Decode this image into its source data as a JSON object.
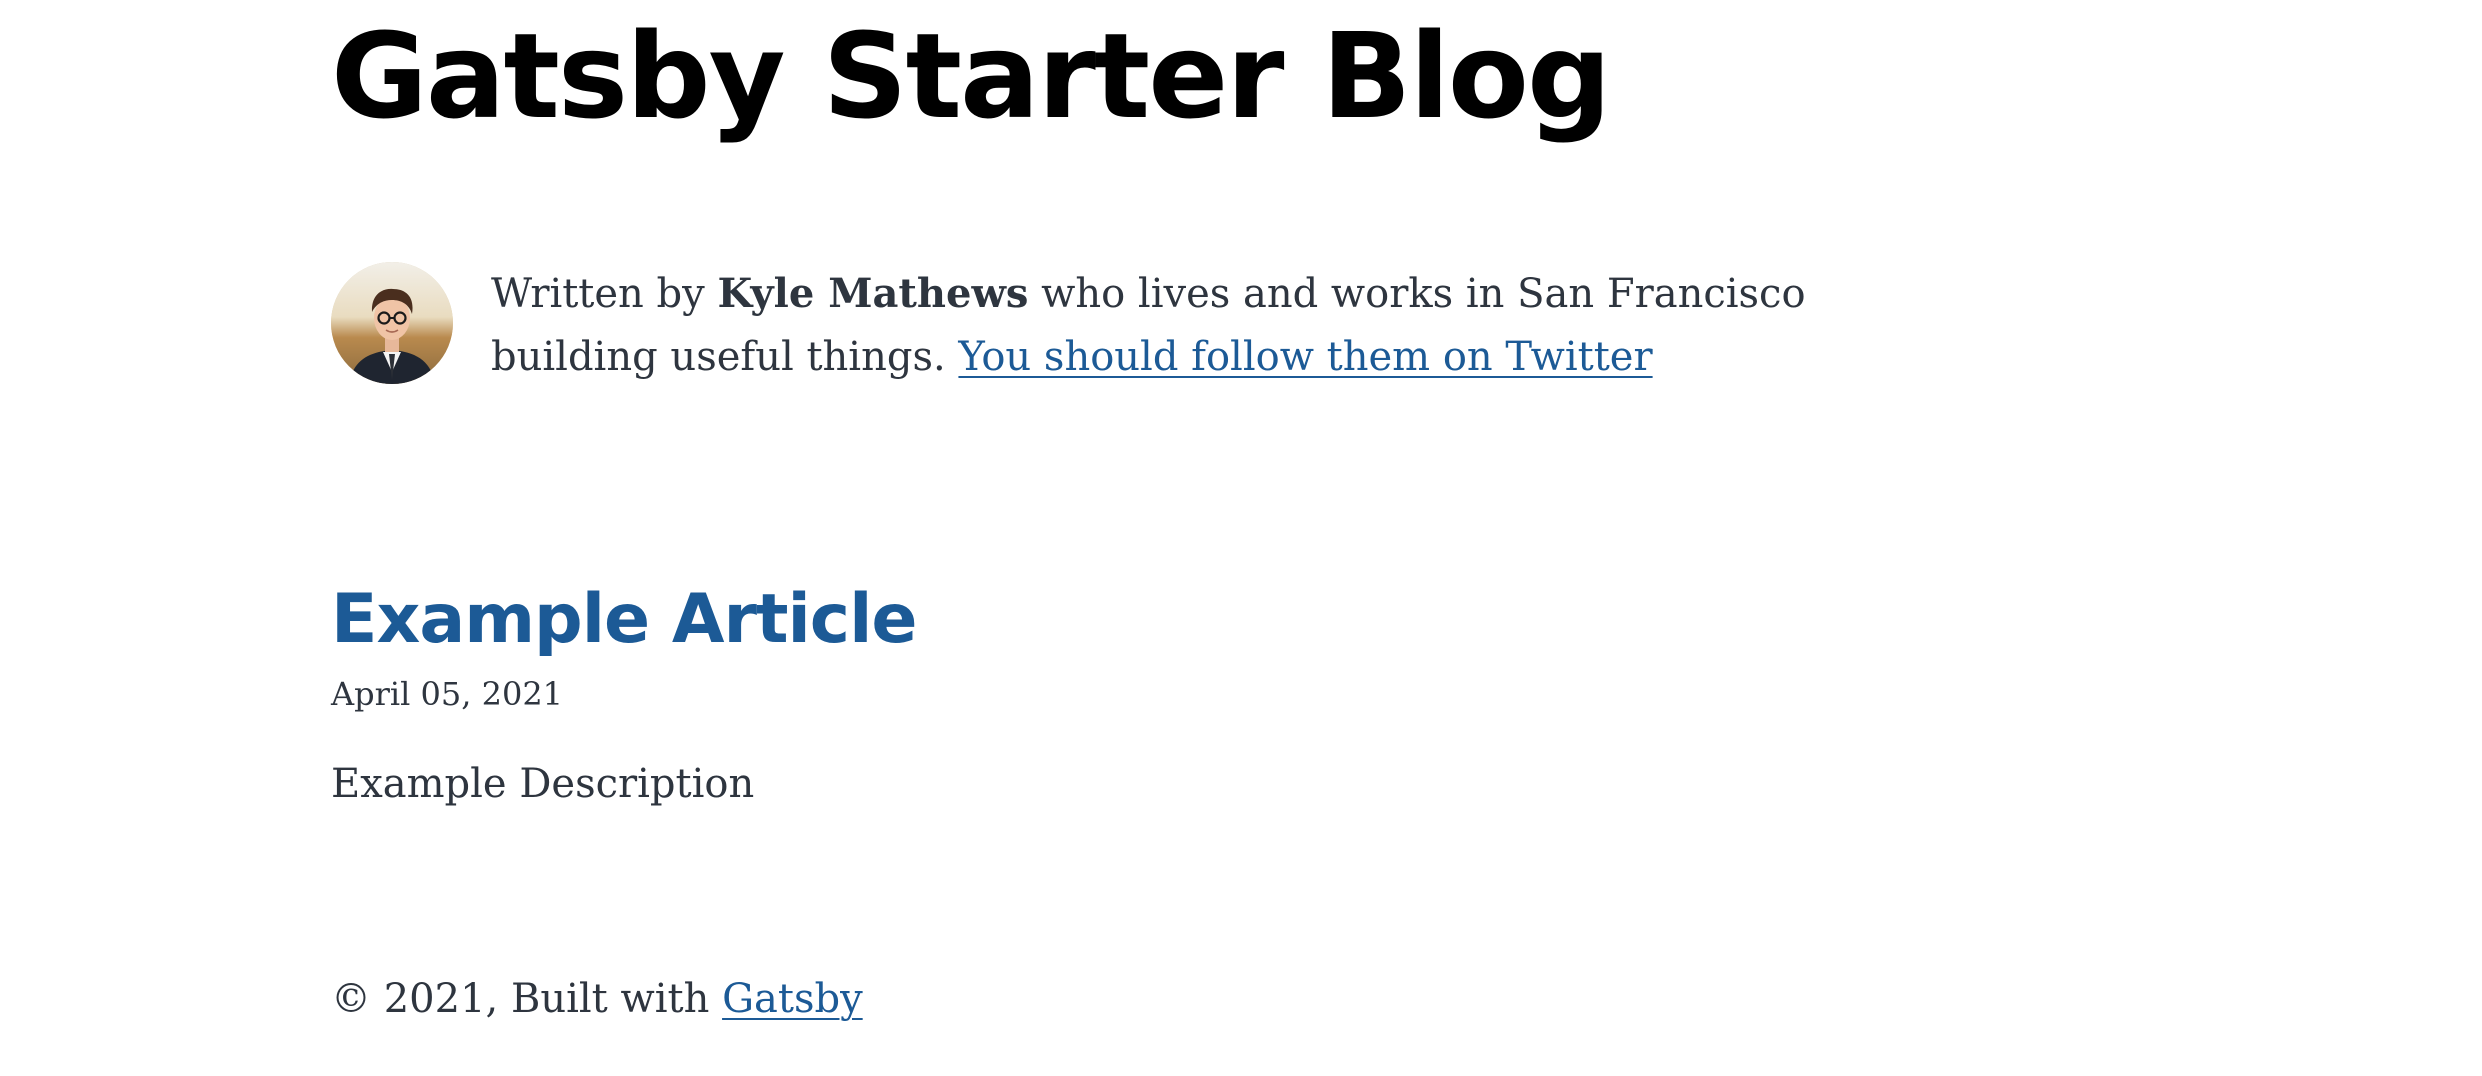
{
  "header": {
    "title": "Gatsby Starter Blog"
  },
  "bio": {
    "prefix": "Written by ",
    "author": "Kyle Mathews",
    "middle": " who lives and works in San Francisco building useful things. ",
    "twitter_link": "You should follow them on Twitter",
    "avatar_icon": "profile-photo"
  },
  "posts": [
    {
      "title": "Example Article",
      "date": "April 05, 2021",
      "description": "Example Description"
    }
  ],
  "footer": {
    "copyright": "© 2021, Built with ",
    "link": "Gatsby"
  },
  "colors": {
    "link": "#1c5a96",
    "text": "#2e353f",
    "heading": "#000000"
  }
}
